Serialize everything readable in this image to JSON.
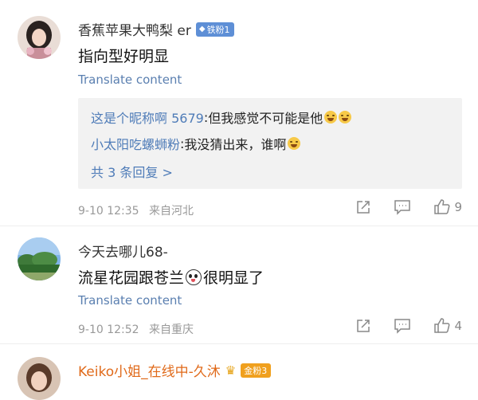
{
  "comments": [
    {
      "author": "香蕉苹果大鸭梨 er",
      "badge": "铁粉1",
      "text": "指向型好明显",
      "translate": "Translate content",
      "replies": [
        {
          "name": "这是个昵称啊 5679",
          "sep": ": ",
          "text": "但我感觉不可能是他",
          "emojis": 2
        },
        {
          "name": "小太阳吃螺蛳粉",
          "sep": ": ",
          "text": "我没猜出来，谁啊",
          "emojis": 1
        }
      ],
      "more_replies": "共 3 条回复 >",
      "time": "9-10 12:35",
      "location": "来自河北",
      "likes": "9"
    },
    {
      "author": "今天去哪儿68-",
      "text_before": "流星花园跟苍兰",
      "text_after": "很明显了",
      "translate": "Translate content",
      "time": "9-10 12:52",
      "location": "来自重庆",
      "likes": "4"
    },
    {
      "author": "Keiko小姐_在线中-久沐",
      "badge": "金粉3"
    }
  ],
  "colors": {
    "link_blue": "#5a7fb0",
    "reply_name_blue": "#4f7cb8",
    "iron_badge": "#5e8fd6",
    "gold_badge": "#f0a01e",
    "gold_name": "#e06a1a"
  },
  "icons": [
    "share-icon",
    "comment-icon",
    "like-icon",
    "crown-icon",
    "panda-emoji",
    "laugh-emoji"
  ]
}
